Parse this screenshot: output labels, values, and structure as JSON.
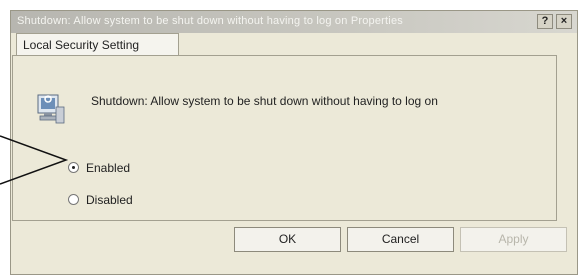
{
  "window": {
    "title": "Shutdown: Allow system to be shut down without having to log on Properties",
    "help_label": "?",
    "close_label": "×"
  },
  "tabs": [
    {
      "label": "Local Security Setting"
    }
  ],
  "policy": {
    "description": "Shutdown: Allow system to be shut down without having to log on",
    "icon": "policy-computer-icon"
  },
  "options": [
    {
      "label": "Enabled",
      "selected": true
    },
    {
      "label": "Disabled",
      "selected": false
    }
  ],
  "buttons": {
    "ok_label": "OK",
    "cancel_label": "Cancel",
    "apply_label": "Apply"
  },
  "callout": {
    "icon": "callout-arrow-icon"
  }
}
